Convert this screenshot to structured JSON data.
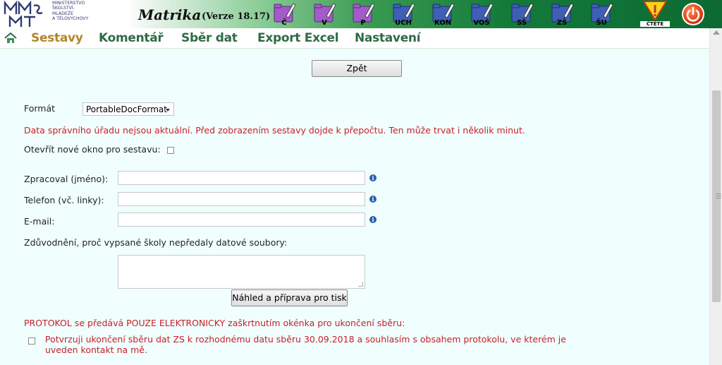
{
  "header": {
    "logo_lines": [
      "MINISTERSTVO",
      "ŠKOLSTVÍ,",
      "MLÁDEŽE",
      "A TĚLOVÝCHOVY"
    ],
    "app_title": "Matrika",
    "app_version": "(Verze 18.17)",
    "module_icons": [
      {
        "label": "Č",
        "icon": "folder-pen-icon"
      },
      {
        "label": "V",
        "icon": "folder-pen-icon"
      },
      {
        "label": "P",
        "icon": "folder-pen-icon"
      },
      {
        "label": "UCH",
        "icon": "folder-pen-icon"
      },
      {
        "label": "KON",
        "icon": "folder-pen-icon"
      },
      {
        "label": "VOŠ",
        "icon": "folder-pen-icon"
      },
      {
        "label": "SŠ",
        "icon": "folder-pen-icon"
      },
      {
        "label": "ZŠ",
        "icon": "folder-pen-icon"
      },
      {
        "label": "ŠU",
        "icon": "folder-pen-icon"
      }
    ],
    "warning_label": "ČTĚTE",
    "colors": {
      "purple_icon": "#a25bc9",
      "blue_icon": "#3f5fb6",
      "green_dark": "#0c6a32"
    }
  },
  "nav": {
    "items": [
      "Sestavy",
      "Komentář",
      "Sběr dat",
      "Export Excel",
      "Nastavení"
    ],
    "active": "Sestavy"
  },
  "form": {
    "back_button": "Zpět",
    "format_label": "Formát",
    "format_selected": "PortableDocFormat",
    "warning_text": "Data správního úřadu nejsou aktuální. Před zobrazením sestavy dojde k přepočtu. Ten může trvat i několik minut.",
    "new_window_label": "Otevřít nové okno pro sestavu:",
    "fields": [
      {
        "label": "Zpracoval (jméno):",
        "value": ""
      },
      {
        "label": "Telefon (vč. linky):",
        "value": ""
      },
      {
        "label": "E-mail:",
        "value": ""
      }
    ],
    "justification_label": "Zdůvodnění, proč vypsané školy nepředaly datové soubory:",
    "justification_value": "",
    "preview_button": "Náhled a příprava pro tisk",
    "protocol_text": "PROTOKOL se předává POUZE ELEKTRONICKY zaškrtnutím okénka pro ukončení sběru:",
    "confirm_text": "Potvrzuji ukončení sběru dat ZS k rozhodnému datu sběru 30.09.2018 a souhlasím s obsahem protokolu, ve kterém je uveden kontakt na mě."
  }
}
